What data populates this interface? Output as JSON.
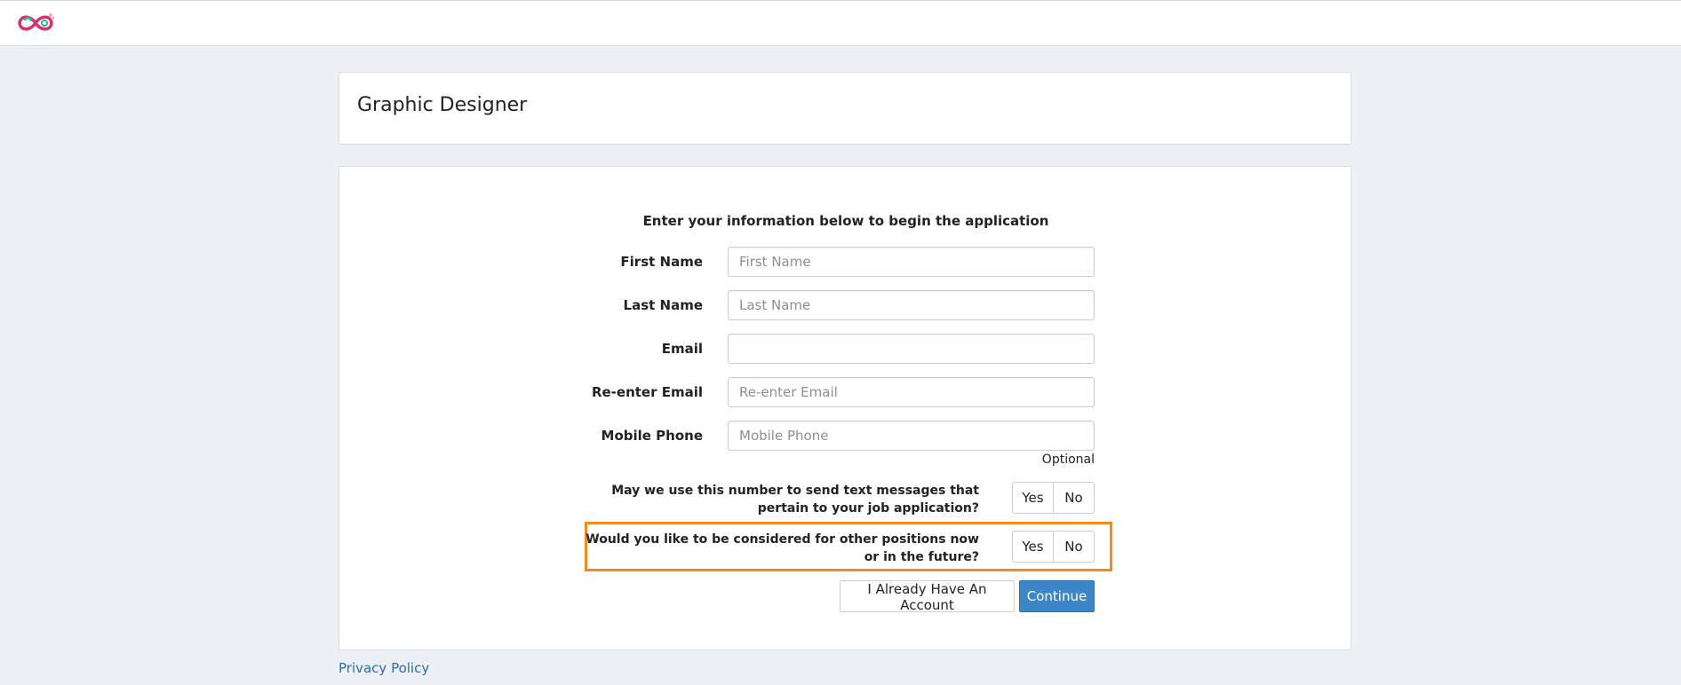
{
  "job": {
    "title": "Graphic Designer"
  },
  "form": {
    "intro": "Enter your information below to begin the application",
    "fields": [
      {
        "label": "First Name",
        "value": "",
        "placeholder": "First Name"
      },
      {
        "label": "Last Name",
        "value": "",
        "placeholder": "Last Name"
      },
      {
        "label": "Email",
        "value": "",
        "placeholder": ""
      },
      {
        "label": "Re-enter Email",
        "value": "",
        "placeholder": "Re-enter Email"
      },
      {
        "label": "Mobile Phone",
        "value": "",
        "placeholder": "Mobile Phone"
      }
    ],
    "optional_note": "Optional",
    "questions": [
      {
        "text": "May we use this number to send text messages that pertain to your job application?",
        "yes": "Yes",
        "no": "No"
      },
      {
        "text": "Would you like to be considered for other positions now or in the future?",
        "yes": "Yes",
        "no": "No"
      }
    ],
    "account_button": "I Already Have An Account",
    "continue_button": "Continue"
  },
  "footer": {
    "privacy_link": "Privacy Policy"
  },
  "colors": {
    "accent": "#3d85c9",
    "highlight": "#f08c1e",
    "background": "#edf1f5"
  }
}
